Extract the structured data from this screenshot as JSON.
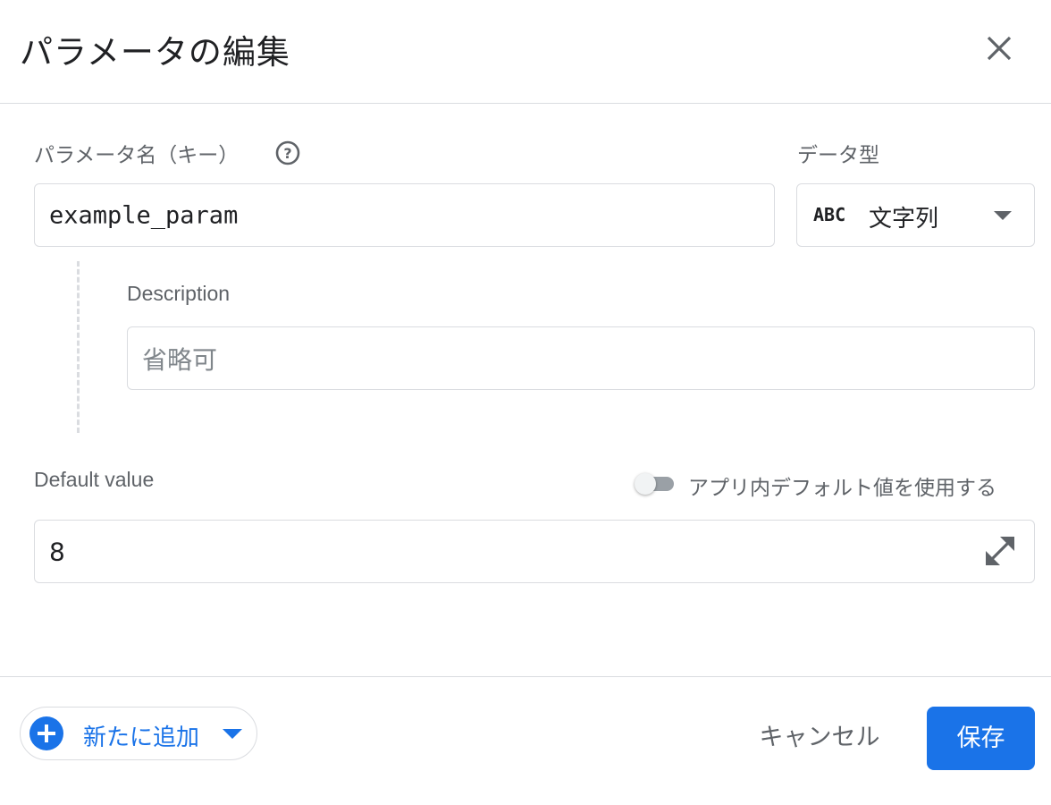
{
  "dialog": {
    "title": "パラメータの編集"
  },
  "param_name": {
    "label": "パラメータ名（キー）",
    "value": "example_param"
  },
  "data_type": {
    "label": "データ型",
    "icon_text": "ABC",
    "value": "文字列"
  },
  "description": {
    "label": "Description",
    "placeholder": "省略可"
  },
  "default_value": {
    "label": "Default value",
    "toggle_label": "アプリ内デフォルト値を使用する",
    "value": "8"
  },
  "footer": {
    "add_new_label": "新たに追加",
    "cancel_label": "キャンセル",
    "save_label": "保存"
  },
  "icons": {
    "close": "close-icon",
    "help": "help-icon",
    "dropdown": "chevron-down-icon",
    "expand": "expand-icon",
    "add": "plus-icon"
  },
  "colors": {
    "accent": "#1a73e8",
    "border": "#dadce0",
    "label": "#5f6368"
  }
}
